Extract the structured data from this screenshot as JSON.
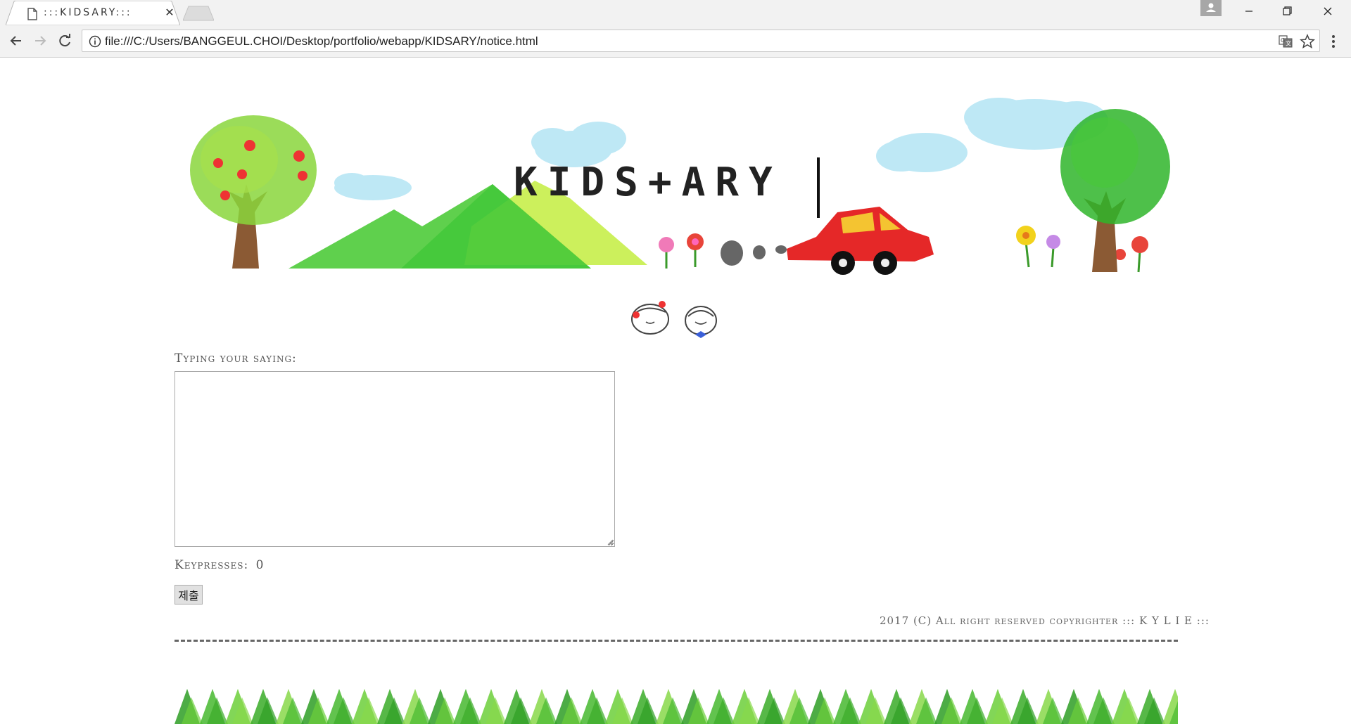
{
  "browser": {
    "tab_title": ":::KIDSARY:::",
    "url": "file:///C:/Users/BANGGEUL.CHOI/Desktop/portfolio/webapp/KIDSARY/notice.html",
    "icons": [
      "page-icon",
      "close-icon",
      "back-arrow-icon",
      "forward-arrow-icon",
      "reload-icon",
      "info-icon",
      "translate-icon",
      "star-icon",
      "menu-dots-icon",
      "profile-icon",
      "minimize-icon",
      "restore-icon",
      "window-close-icon"
    ]
  },
  "header": {
    "logo": "KIDS+ARY"
  },
  "form": {
    "prompt_label": "Typing your saying:",
    "textarea_value": "",
    "keypresses_label": "Keypresses:",
    "keypresses_count": "0",
    "submit_label": "제출"
  },
  "footer": {
    "copyright": "2017 (C) All right reserved copyrighter ::: K Y L I E :::"
  },
  "colors": {
    "chrome_bg": "#f2f2f2",
    "grass_green": "#3fae2a",
    "car_red": "#e02020",
    "sky_blue": "#a8dff0"
  }
}
